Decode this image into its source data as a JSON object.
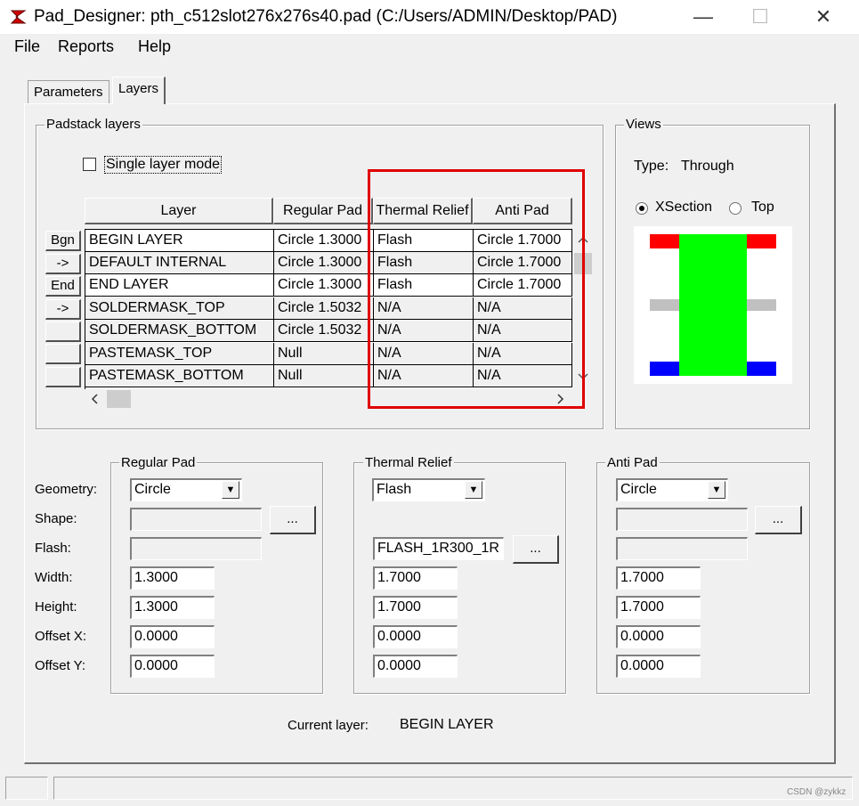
{
  "window": {
    "title": "Pad_Designer: pth_c512slot276x276s40.pad (C:/Users/ADMIN/Desktop/PAD)",
    "minimize": "—",
    "maximize": "☐",
    "close": "✕"
  },
  "menu": {
    "file": "File",
    "reports": "Reports",
    "help": "Help"
  },
  "tabs": {
    "parameters": "Parameters",
    "layers": "Layers"
  },
  "padstack": {
    "group_label": "Padstack layers",
    "single_layer_mode": "Single layer mode",
    "headers": [
      "Layer",
      "Regular Pad",
      "Thermal Relief",
      "Anti Pad"
    ],
    "rows": [
      {
        "btn": "Bgn",
        "layer": "BEGIN LAYER",
        "regular": "Circle 1.3000",
        "thermal": "Flash",
        "anti": "Circle 1.7000"
      },
      {
        "btn": "->",
        "layer": "DEFAULT INTERNAL",
        "regular": "Circle 1.3000",
        "thermal": "Flash",
        "anti": "Circle 1.7000"
      },
      {
        "btn": "End",
        "layer": "END LAYER",
        "regular": "Circle 1.3000",
        "thermal": "Flash",
        "anti": "Circle 1.7000"
      },
      {
        "btn": "->",
        "layer": "SOLDERMASK_TOP",
        "regular": "Circle 1.5032",
        "thermal": "N/A",
        "anti": "N/A"
      },
      {
        "btn": "",
        "layer": "SOLDERMASK_BOTTOM",
        "regular": "Circle 1.5032",
        "thermal": "N/A",
        "anti": "N/A"
      },
      {
        "btn": "",
        "layer": "PASTEMASK_TOP",
        "regular": "Null",
        "thermal": "N/A",
        "anti": "N/A"
      },
      {
        "btn": "",
        "layer": "PASTEMASK_BOTTOM",
        "regular": "Null",
        "thermal": "N/A",
        "anti": "N/A"
      }
    ],
    "scroll_left": "<",
    "scroll_right": ">",
    "scroll_up": "^",
    "scroll_down": "v"
  },
  "views": {
    "group_label": "Views",
    "type_label": "Type:",
    "type_value": "Through",
    "xsection": "XSection",
    "top": "Top",
    "colors": {
      "top_pad": "#ff0000",
      "bottom_pad": "#0000ff",
      "inner": "#c0c0c0",
      "drill": "#00ff00"
    }
  },
  "form": {
    "labels": [
      "Geometry:",
      "Shape:",
      "Flash:",
      "Width:",
      "Height:",
      "Offset X:",
      "Offset Y:"
    ],
    "regular": {
      "label": "Regular Pad",
      "geometry": "Circle",
      "shape": "",
      "flash": "",
      "width": "1.3000",
      "height": "1.3000",
      "offset_x": "0.0000",
      "offset_y": "0.0000",
      "browse": "..."
    },
    "thermal": {
      "label": "Thermal Relief",
      "geometry": "Flash",
      "flash": "FLASH_1R300_1R",
      "width": "1.7000",
      "height": "1.7000",
      "offset_x": "0.0000",
      "offset_y": "0.0000",
      "browse": "..."
    },
    "anti": {
      "label": "Anti Pad",
      "geometry": "Circle",
      "shape": "",
      "flash": "",
      "width": "1.7000",
      "height": "1.7000",
      "offset_x": "0.0000",
      "offset_y": "0.0000",
      "browse": "..."
    },
    "dropdown_arrow": "▼"
  },
  "current_layer": {
    "label": "Current layer:",
    "value": "BEGIN LAYER"
  },
  "watermark": "CSDN @zykkz",
  "annotation": {
    "color": "#e00000"
  }
}
